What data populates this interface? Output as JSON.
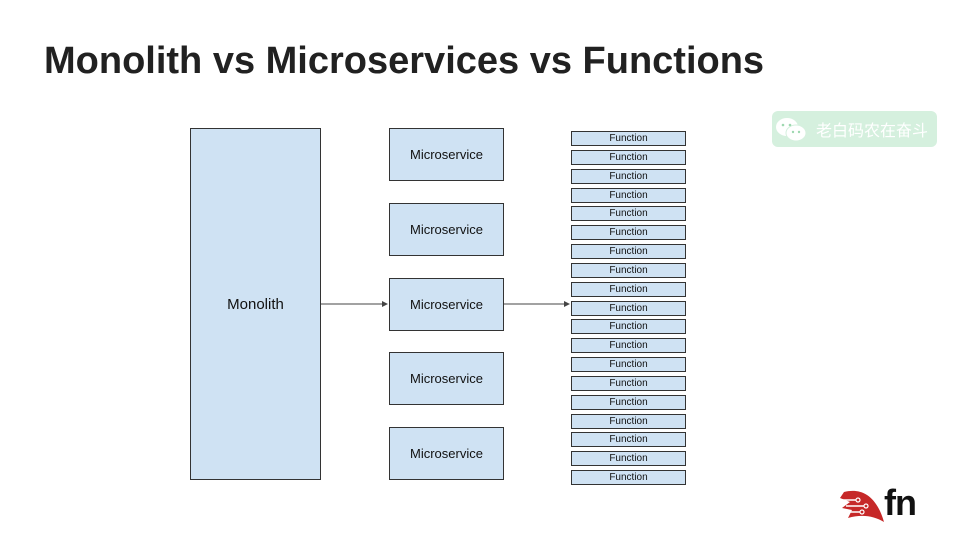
{
  "slide": {
    "title": "Monolith vs Microservices vs Functions"
  },
  "diagram": {
    "monolith": {
      "label": "Monolith"
    },
    "microservices": [
      {
        "label": "Microservice"
      },
      {
        "label": "Microservice"
      },
      {
        "label": "Microservice"
      },
      {
        "label": "Microservice"
      },
      {
        "label": "Microservice"
      }
    ],
    "functions": [
      "Function",
      "Function",
      "Function",
      "Function",
      "Function",
      "Function",
      "Function",
      "Function",
      "Function",
      "Function",
      "Function",
      "Function",
      "Function",
      "Function",
      "Function",
      "Function",
      "Function",
      "Function",
      "Function"
    ],
    "colors": {
      "box_fill": "#cfe2f3",
      "box_border": "#333333",
      "arrow": "#444444"
    }
  },
  "watermark": {
    "text": "老白码农在奋斗",
    "icon": "wechat-icon",
    "color": "#d5f0de"
  },
  "logo": {
    "text": "fn",
    "icon": "fn-project-logo-icon",
    "color": "#c62828"
  }
}
